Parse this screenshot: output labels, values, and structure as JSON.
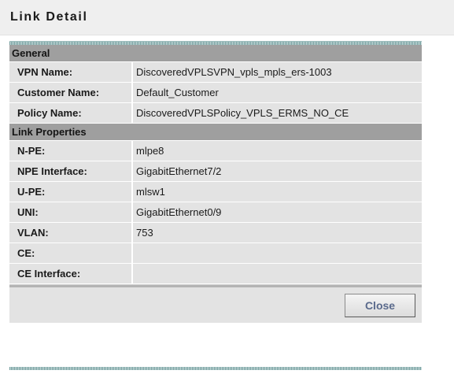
{
  "page": {
    "title": "Link Detail"
  },
  "sections": [
    {
      "title": "General",
      "rows": [
        {
          "label": "VPN Name:",
          "value": "DiscoveredVPLSVPN_vpls_mpls_ers-1003"
        },
        {
          "label": "Customer Name:",
          "value": "Default_Customer"
        },
        {
          "label": "Policy Name:",
          "value": "DiscoveredVPLSPolicy_VPLS_ERMS_NO_CE"
        }
      ]
    },
    {
      "title": "Link Properties",
      "rows": [
        {
          "label": "N-PE:",
          "value": "mlpe8"
        },
        {
          "label": "NPE Interface:",
          "value": "GigabitEthernet7/2"
        },
        {
          "label": "U-PE:",
          "value": "mlsw1"
        },
        {
          "label": "UNI:",
          "value": "GigabitEthernet0/9"
        },
        {
          "label": "VLAN:",
          "value": "753"
        },
        {
          "label": "CE:",
          "value": ""
        },
        {
          "label": "CE Interface:",
          "value": ""
        }
      ]
    }
  ],
  "footer": {
    "close_label": "Close"
  },
  "colors": {
    "section_header_bg": "#9f9f9f",
    "row_bg": "#e3e3e3",
    "button_text": "#5a6a8c",
    "rule_accent": "#6f9b9b"
  }
}
